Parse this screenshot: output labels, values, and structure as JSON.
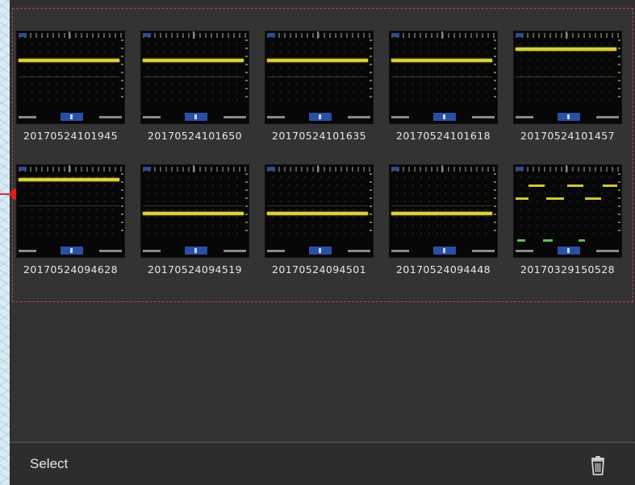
{
  "gallery": {
    "items": [
      {
        "label": "20170524101945"
      },
      {
        "label": "20170524101650"
      },
      {
        "label": "20170524101635"
      },
      {
        "label": "20170524101618"
      },
      {
        "label": "20170524101457"
      },
      {
        "label": "20170524094628"
      },
      {
        "label": "20170524094519"
      },
      {
        "label": "20170524094501"
      },
      {
        "label": "20170524094448"
      },
      {
        "label": "20170329150528"
      }
    ]
  },
  "footer": {
    "select_label": "Select",
    "delete_icon": "trash-icon"
  },
  "colors": {
    "panel": "#333333",
    "trace": "#d7cf3c",
    "selection_border": "#d23a3a",
    "handle": "#e02020"
  }
}
